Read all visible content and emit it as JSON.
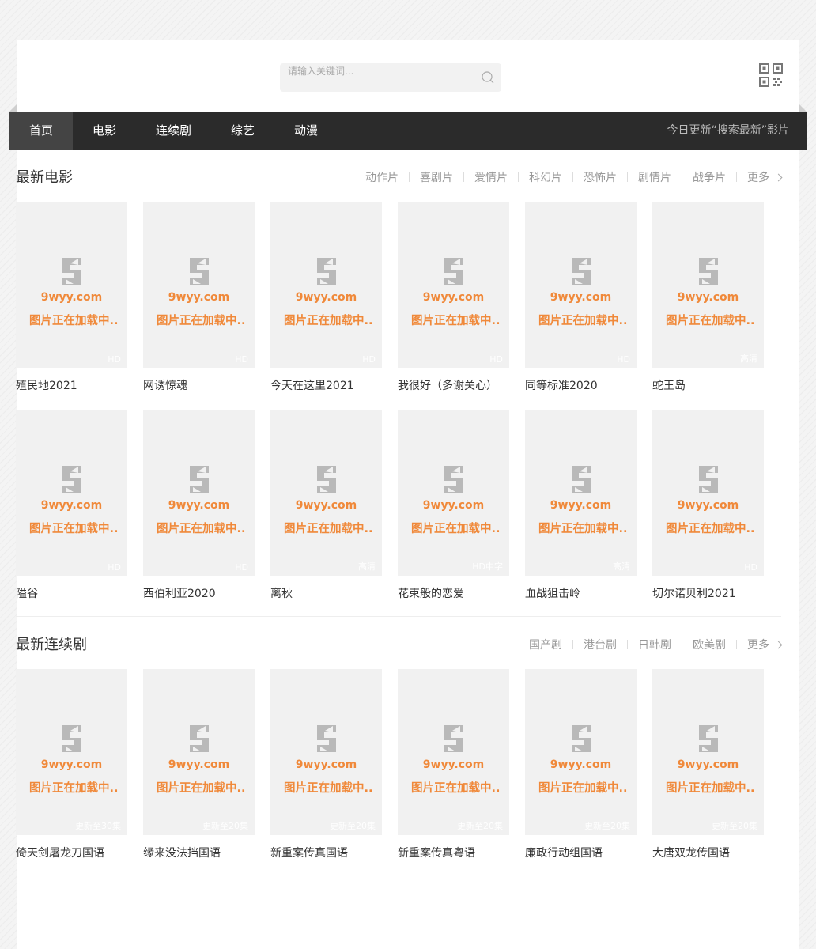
{
  "search": {
    "placeholder": "请输入关键词..."
  },
  "nav": {
    "items": [
      {
        "label": "首页",
        "active": true
      },
      {
        "label": "电影"
      },
      {
        "label": "连续剧"
      },
      {
        "label": "综艺"
      },
      {
        "label": "动漫"
      }
    ],
    "notice": "今日更新“搜索最新”影片"
  },
  "placeholder": {
    "site": "9wyy.com",
    "loading": "图片正在加载中.."
  },
  "movies": {
    "title": "最新电影",
    "links": [
      "动作片",
      "喜剧片",
      "爱情片",
      "科幻片",
      "恐怖片",
      "剧情片",
      "战争片"
    ],
    "more": "更多",
    "items": [
      {
        "title": "殖民地2021",
        "badge": "HD"
      },
      {
        "title": "网诱惊魂",
        "badge": "HD"
      },
      {
        "title": "今天在这里2021",
        "badge": "HD"
      },
      {
        "title": "我很好（多谢关心）",
        "badge": "HD"
      },
      {
        "title": "同等标准2020",
        "badge": "HD"
      },
      {
        "title": "蛇王岛",
        "badge": "高清"
      },
      {
        "title": "隘谷",
        "badge": "HD"
      },
      {
        "title": "西伯利亚2020",
        "badge": "HD"
      },
      {
        "title": "离秋",
        "badge": "高清"
      },
      {
        "title": "花束般的恋爱",
        "badge": "HD中字"
      },
      {
        "title": "血战狙击岭",
        "badge": "高清"
      },
      {
        "title": "切尔诺贝利2021",
        "badge": "HD"
      }
    ]
  },
  "series": {
    "title": "最新连续剧",
    "links": [
      "国产剧",
      "港台剧",
      "日韩剧",
      "欧美剧"
    ],
    "more": "更多",
    "items": [
      {
        "title": "倚天剑屠龙刀国语",
        "badge": "更新至30集"
      },
      {
        "title": "缘来没法挡国语",
        "badge": "更新至20集"
      },
      {
        "title": "新重案传真国语",
        "badge": "更新至20集"
      },
      {
        "title": "新重案传真粤语",
        "badge": "更新至20集"
      },
      {
        "title": "廉政行动组国语",
        "badge": "更新至20集"
      },
      {
        "title": "大唐双龙传国语",
        "badge": "更新至20集"
      }
    ]
  }
}
